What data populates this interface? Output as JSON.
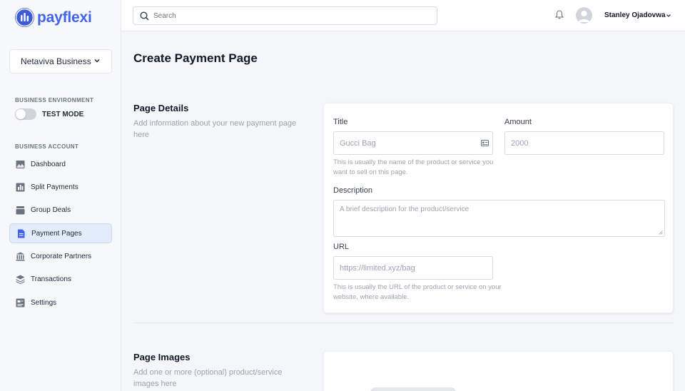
{
  "brand": {
    "name": "payflexi",
    "accent": "#4263eb"
  },
  "sidebar": {
    "business_selector": "Netaviva Business",
    "env_label": "BUSINESS ENVIRONMENT",
    "test_mode_label": "TEST MODE",
    "test_mode_on": false,
    "account_label": "BUSINESS ACCOUNT",
    "items": [
      {
        "label": "Dashboard",
        "icon": "chart-image-icon"
      },
      {
        "label": "Split Payments",
        "icon": "bar-chart-icon"
      },
      {
        "label": "Group Deals",
        "icon": "stack-icon"
      },
      {
        "label": "Payment Pages",
        "icon": "document-icon",
        "active": true
      },
      {
        "label": "Corporate Partners",
        "icon": "bank-icon"
      },
      {
        "label": "Transactions",
        "icon": "layers-icon"
      },
      {
        "label": "Settings",
        "icon": "settings-panel-icon"
      }
    ]
  },
  "topbar": {
    "search_placeholder": "Search",
    "user_name": "Stanley Ojadovwa"
  },
  "main": {
    "title": "Create Payment Page",
    "page_details": {
      "title": "Page Details",
      "description": "Add information about your new payment page here",
      "fields": {
        "title_label": "Title",
        "title_placeholder": "Gucci Bag",
        "title_hint": "This is usually the name of the product or service you want to sell on this page.",
        "amount_label": "Amount",
        "amount_placeholder": "2000",
        "description_label": "Description",
        "description_placeholder": "A brief description for the product/service",
        "url_label": "URL",
        "url_placeholder": "https://limited.xyz/bag",
        "url_hint": "This is usually the URL of the product or service on your website, where available."
      }
    },
    "page_images": {
      "title": "Page Images",
      "description": "Add one or more (optional) product/service images here"
    }
  }
}
